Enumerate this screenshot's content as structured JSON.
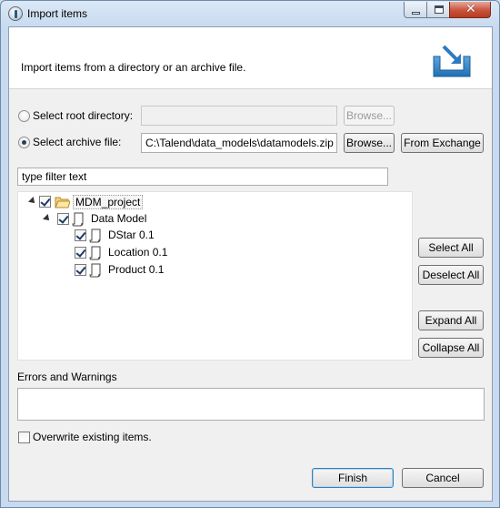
{
  "window": {
    "title": "Import items",
    "minimize_icon": "minimize-icon",
    "maximize_icon": "maximize-icon",
    "close_glyph": "✕"
  },
  "banner": {
    "description": "Import items from a directory or an archive file.",
    "icon": "import-tray-icon"
  },
  "source": {
    "root_directory": {
      "label": "Select root directory:",
      "value": "",
      "selected": false,
      "browse_label": "Browse...",
      "browse_enabled": false
    },
    "archive_file": {
      "label": "Select archive file:",
      "value": "C:\\Talend\\data_models\\datamodels.zip",
      "selected": true,
      "browse_label": "Browse...",
      "exchange_label": "From Exchange"
    }
  },
  "filter": {
    "value": "type filter text"
  },
  "tree": [
    {
      "label": "MDM_project",
      "level": 0,
      "checked": true,
      "icon": "folder-icon",
      "expanded": true
    },
    {
      "label": "Data Model",
      "level": 1,
      "checked": true,
      "icon": "document-icon",
      "expanded": true
    },
    {
      "label": "DStar 0.1",
      "level": 2,
      "checked": true,
      "icon": "document-icon"
    },
    {
      "label": "Location 0.1",
      "level": 2,
      "checked": true,
      "icon": "document-icon"
    },
    {
      "label": "Product 0.1",
      "level": 2,
      "checked": true,
      "icon": "document-icon"
    }
  ],
  "tree_buttons": {
    "select_all": "Select All",
    "deselect_all": "Deselect All",
    "expand_all": "Expand All",
    "collapse_all": "Collapse All"
  },
  "errors": {
    "label": "Errors and Warnings",
    "content": ""
  },
  "overwrite": {
    "label": "Overwrite existing items.",
    "checked": false
  },
  "footer": {
    "finish": "Finish",
    "cancel": "Cancel"
  }
}
